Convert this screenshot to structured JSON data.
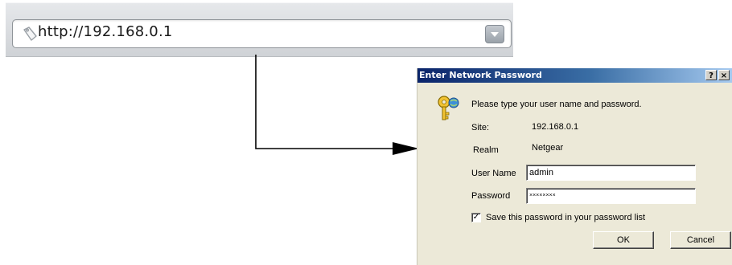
{
  "browser": {
    "address_url": "http://192.168.0.1",
    "icons": {
      "page": "page-icon",
      "dropdown": "chevron-down-icon"
    }
  },
  "dialog": {
    "title": "Enter Network Password",
    "help_button": "?",
    "close_button": "×",
    "prompt": "Please type your user name and password.",
    "site_label": "Site:",
    "site_value": "192.168.0.1",
    "realm_label": "Realm",
    "realm_value": "Netgear",
    "username_label": "User Name",
    "username_value": "admin",
    "password_label": "Password",
    "password_value": "××××××××",
    "save_password_label": "Save this password in your password list",
    "save_password_checked": true,
    "ok_label": "OK",
    "cancel_label": "Cancel",
    "key_icon": "key-icon"
  },
  "colors": {
    "titlebar_start": "#0a246a",
    "titlebar_end": "#a6caf0",
    "dialog_bg": "#ece9d8"
  }
}
